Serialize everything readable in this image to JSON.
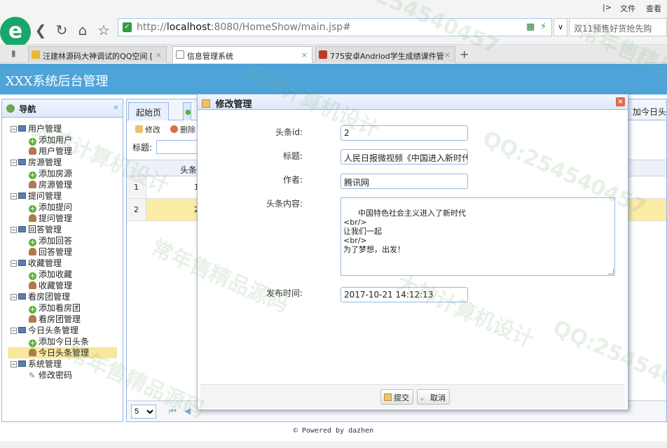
{
  "browser": {
    "menu": {
      "file": "文件",
      "view": "查看",
      "collapse": "|>"
    },
    "address": {
      "url_prefix": "http://",
      "url_host": "localhost",
      "url_rest": ":8080/HomeShow/main.jsp#"
    },
    "search_placeholder": "双11预售好货抢先购",
    "tabs": [
      {
        "title": "汪建林源码大神调试的QQ空间 [",
        "active": false,
        "fav_color": "#e8b931"
      },
      {
        "title": "信息管理系统",
        "active": true,
        "fav_color": "#ffffff"
      },
      {
        "title": "775安卓Andriod学生成绩课件管",
        "active": false,
        "fav_color": "#c0392b"
      }
    ],
    "newtab": "+"
  },
  "app": {
    "title": "XXX系统后台管理",
    "accent": "#4ea4d9",
    "nav_title": "导航",
    "nav_collapse": "«",
    "tree": [
      {
        "label": "用户管理",
        "children": [
          {
            "label": "添加用户",
            "icon": "add"
          },
          {
            "label": "用户管理",
            "icon": "user"
          }
        ]
      },
      {
        "label": "房源管理",
        "children": [
          {
            "label": "添加房源",
            "icon": "add"
          },
          {
            "label": "房源管理",
            "icon": "user"
          }
        ]
      },
      {
        "label": "提问管理",
        "children": [
          {
            "label": "添加提问",
            "icon": "add"
          },
          {
            "label": "提问管理",
            "icon": "user"
          }
        ]
      },
      {
        "label": "回答管理",
        "children": [
          {
            "label": "添加回答",
            "icon": "add"
          },
          {
            "label": "回答管理",
            "icon": "user"
          }
        ]
      },
      {
        "label": "收藏管理",
        "children": [
          {
            "label": "添加收藏",
            "icon": "add"
          },
          {
            "label": "收藏管理",
            "icon": "user"
          }
        ]
      },
      {
        "label": "看房团管理",
        "children": [
          {
            "label": "添加看房团",
            "icon": "add"
          },
          {
            "label": "看房团管理",
            "icon": "user"
          }
        ]
      },
      {
        "label": "今日头条管理",
        "children": [
          {
            "label": "添加今日头条",
            "icon": "add"
          },
          {
            "label": "今日头条管理",
            "icon": "user",
            "selected": true
          }
        ]
      },
      {
        "label": "系统管理",
        "children": [
          {
            "label": "修改密码",
            "icon": "pen"
          }
        ]
      }
    ],
    "main_tabs": [
      "起始页",
      "加今日头"
    ],
    "toolbar": {
      "edit": "修改",
      "delete": "删除"
    },
    "filter_label": "标题:",
    "grid_header": "头条",
    "rows": [
      {
        "num": "1",
        "val": "1"
      },
      {
        "num": "2",
        "val": "2"
      }
    ],
    "page_size": "5",
    "footer": "© Powered by dazhen"
  },
  "dialog": {
    "title": "修改管理",
    "fields": {
      "id_label": "头条id:",
      "id_value": "2",
      "title_label": "标题:",
      "title_value": "人民日报微视频《中国进入新时代》",
      "author_label": "作者:",
      "author_value": "腾讯网",
      "content_label": "头条内容:",
      "content_value": "中国特色社会主义进入了新时代\n<br/>\n让我们一起\n<br/>\n为了梦想，出发！",
      "time_label": "发布时间:",
      "time_value": "2017-10-21 14:12:13"
    },
    "submit": "提交",
    "cancel": "取消"
  },
  "watermarks": [
    "QQ:254540457",
    "常年售精品源码",
    "大神计算机设计"
  ]
}
